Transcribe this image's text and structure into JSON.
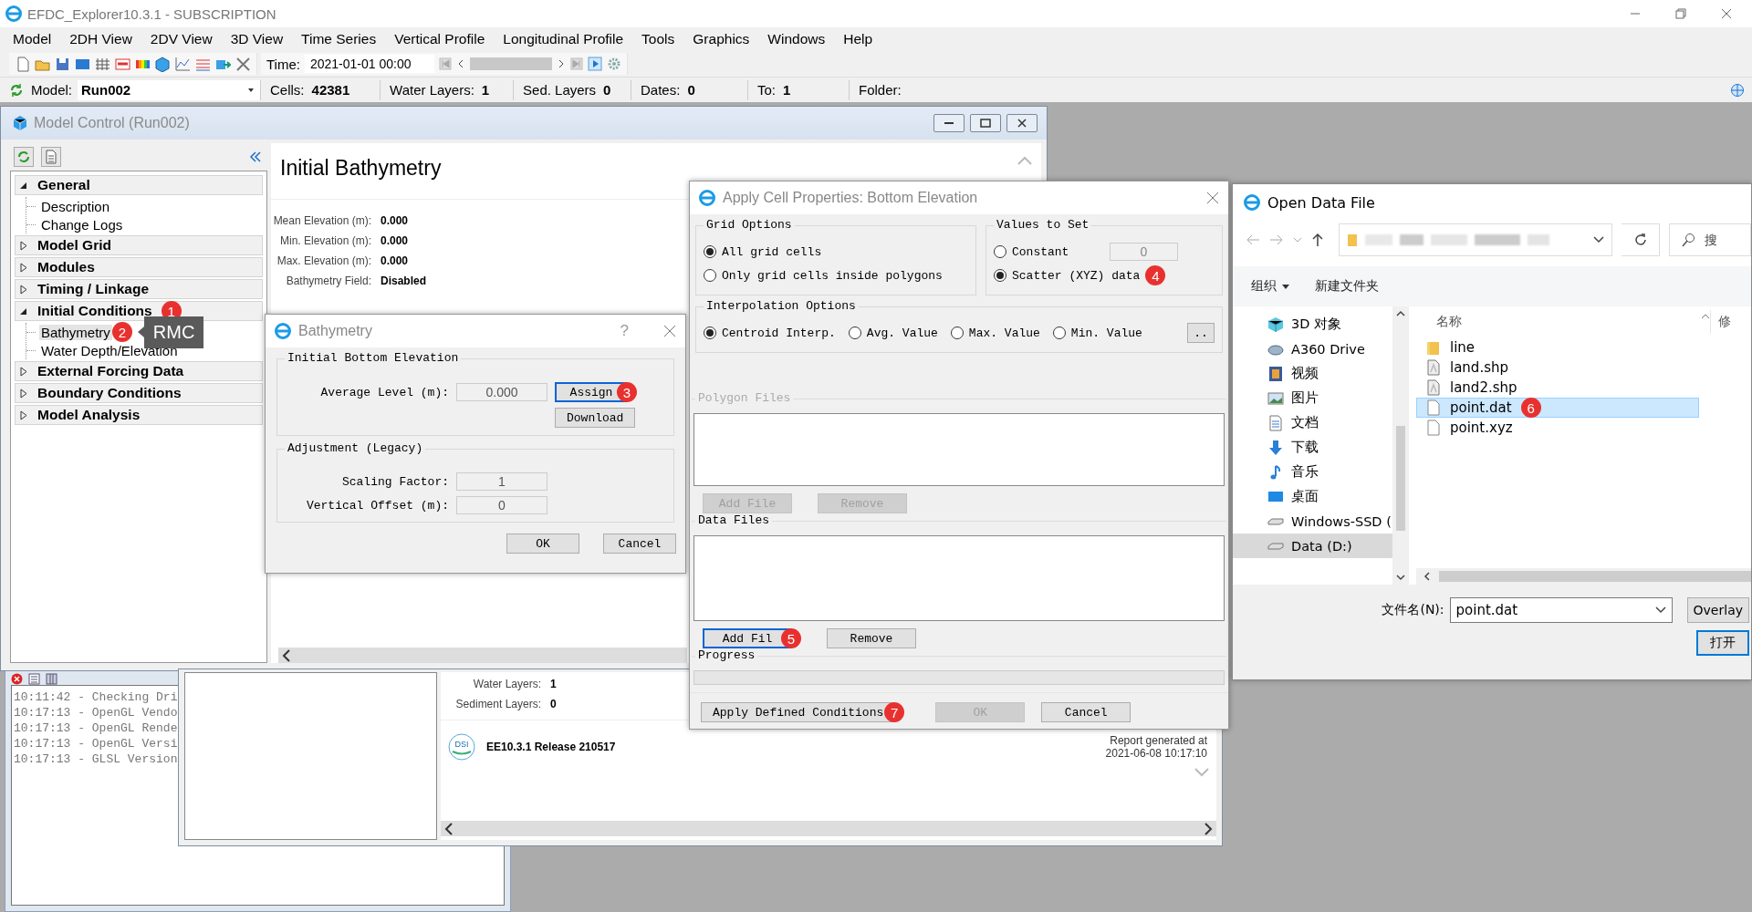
{
  "app": {
    "title": "EFDC_Explorer10.3.1 - SUBSCRIPTION"
  },
  "menu": [
    "Model",
    "2DH View",
    "2DV View",
    "3D View",
    "Time Series",
    "Vertical Profile",
    "Longitudinal Profile",
    "Tools",
    "Graphics",
    "Windows",
    "Help"
  ],
  "toolbar": {
    "time_label": "Time:",
    "time_value": "2021-01-01 00:00"
  },
  "info_bar": {
    "model_label": "Model:",
    "model_value": "Run002",
    "fields": [
      {
        "label": "Cells:",
        "value": "42381"
      },
      {
        "label": "Water Layers:",
        "value": "1"
      },
      {
        "label": "Sed. Layers",
        "value": "0"
      },
      {
        "label": "Dates:",
        "value": "0"
      },
      {
        "label": "To:",
        "value": "1"
      },
      {
        "label": "Folder:"
      }
    ]
  },
  "log": {
    "lines": [
      "10:11:42 - Checking Dri",
      "10:17:13 - OpenGL Vendo",
      "10:17:13 - OpenGL Rende",
      "10:17:13 - OpenGL Versi",
      "10:17:13 - GLSL Version"
    ]
  },
  "model_control": {
    "title": "Model Control (Run002)",
    "heading": "Initial Bathymetry",
    "tree": [
      {
        "label": "General",
        "expanded": true,
        "children": [
          {
            "label": "Description",
            "selected": false
          },
          {
            "label": "Change Logs",
            "selected": false
          }
        ]
      },
      {
        "label": "Model Grid",
        "expanded": false
      },
      {
        "label": "Modules",
        "expanded": false
      },
      {
        "label": "Timing / Linkage",
        "expanded": false
      },
      {
        "label": "Initial Conditions",
        "expanded": true,
        "badge": "1",
        "children": [
          {
            "label": "Bathymetry",
            "selected": true,
            "badge": "2",
            "tooltip": "RMC"
          },
          {
            "label": "Water Depth/Elevation",
            "selected": false
          }
        ]
      },
      {
        "label": "External Forcing Data",
        "expanded": false
      },
      {
        "label": "Boundary Conditions",
        "expanded": false
      },
      {
        "label": "Model Analysis",
        "expanded": false
      }
    ],
    "stats": [
      {
        "label": "Mean Elevation (m):",
        "value": "0.000"
      },
      {
        "label": "Min. Elevation (m):",
        "value": "0.000"
      },
      {
        "label": "Max. Elevation (m):",
        "value": "0.000"
      },
      {
        "label": "Bathymetry Field:",
        "value": "Disabled"
      }
    ]
  },
  "report": {
    "stats": [
      {
        "label": "Water Layers:",
        "value": "1"
      },
      {
        "label": "Sediment Layers:",
        "value": "0"
      }
    ],
    "logo_text": "DSI",
    "release": "EE10.3.1 Release 210517",
    "generated": [
      "Report generated at",
      "2021-06-08 10:17:10"
    ]
  },
  "bathymetry_dialog": {
    "title": "Bathymetry",
    "help": "?",
    "groups": [
      {
        "title": "Initial Bottom Elevation",
        "rows": [
          {
            "label": "Average Level (m):",
            "value": "0.000"
          }
        ],
        "buttons": [
          {
            "label": "Assign",
            "focused": true,
            "badge": "3"
          },
          {
            "label": "Download",
            "focused": false
          }
        ]
      },
      {
        "title": "Adjustment (Legacy)",
        "rows": [
          {
            "label": "Scaling Factor:",
            "value": "1"
          },
          {
            "label": "Vertical Offset (m):",
            "value": "0"
          }
        ]
      }
    ],
    "buttons": [
      {
        "label": "OK"
      },
      {
        "label": "Cancel"
      }
    ]
  },
  "apply_dialog": {
    "title": "Apply Cell Properties: Bottom Elevation",
    "grid_options": {
      "title": "Grid Options",
      "options": [
        {
          "label": "All grid cells",
          "selected": true
        },
        {
          "label": "Only grid cells inside polygons",
          "selected": false
        }
      ]
    },
    "values_to_set": {
      "title": "Values to Set",
      "options": [
        {
          "label": "Constant",
          "selected": false,
          "value": "0"
        },
        {
          "label": "Scatter (XYZ) data",
          "selected": true,
          "badge": "4"
        }
      ]
    },
    "interpolation": {
      "title": "Interpolation Options",
      "more_button": "..",
      "options": [
        {
          "label": "Centroid Interp.",
          "selected": true
        },
        {
          "label": "Avg. Value",
          "selected": false
        },
        {
          "label": "Max. Value",
          "selected": false
        },
        {
          "label": "Min. Value",
          "selected": false
        }
      ]
    },
    "polygon_files": {
      "title": "Polygon Files",
      "disabled": true,
      "buttons": [
        {
          "label": "Add File",
          "focused": false
        },
        {
          "label": "Remove",
          "focused": false
        }
      ]
    },
    "data_files": {
      "title": "Data Files",
      "disabled": false,
      "buttons": [
        {
          "label": "Add Fil",
          "focused": true,
          "badge": "5"
        },
        {
          "label": "Remove",
          "focused": false
        }
      ]
    },
    "progress": {
      "title": "Progress",
      "level": 0
    },
    "buttons": [
      {
        "label": "Apply Defined Conditions",
        "disabled": false,
        "badge": "7"
      },
      {
        "label": "OK",
        "disabled": true
      },
      {
        "label": "Cancel",
        "disabled": false
      }
    ]
  },
  "open_dialog": {
    "title": "Open Data File",
    "search_placeholder": "搜",
    "organize": "组织",
    "new_folder": "新建文件夹",
    "places": [
      {
        "label": "3D 对象",
        "kind": "objects",
        "selected": false
      },
      {
        "label": "A360 Drive",
        "kind": "cloud",
        "selected": false
      },
      {
        "label": "视频",
        "kind": "video",
        "selected": false
      },
      {
        "label": "图片",
        "kind": "pictures",
        "selected": false
      },
      {
        "label": "文档",
        "kind": "documents",
        "selected": false
      },
      {
        "label": "下载",
        "kind": "downloads",
        "selected": false
      },
      {
        "label": "音乐",
        "kind": "music",
        "selected": false
      },
      {
        "label": "桌面",
        "kind": "desktop",
        "selected": false
      },
      {
        "label": "Windows-SSD (",
        "kind": "drive",
        "selected": false
      },
      {
        "label": "Data (D:)",
        "kind": "drive",
        "selected": true
      }
    ],
    "columns": [
      "名称",
      "修"
    ],
    "files": [
      {
        "name": "line",
        "kind": "folder",
        "selected": false
      },
      {
        "name": "land.shp",
        "kind": "shape",
        "selected": false
      },
      {
        "name": "land2.shp",
        "kind": "shape",
        "selected": false
      },
      {
        "name": "point.dat",
        "kind": "file",
        "selected": true,
        "badge": "6"
      },
      {
        "name": "point.xyz",
        "kind": "file",
        "selected": false
      }
    ],
    "filename_label": "文件名(N):",
    "filename": "point.dat",
    "buttons": [
      "Overlay",
      "打开"
    ]
  }
}
